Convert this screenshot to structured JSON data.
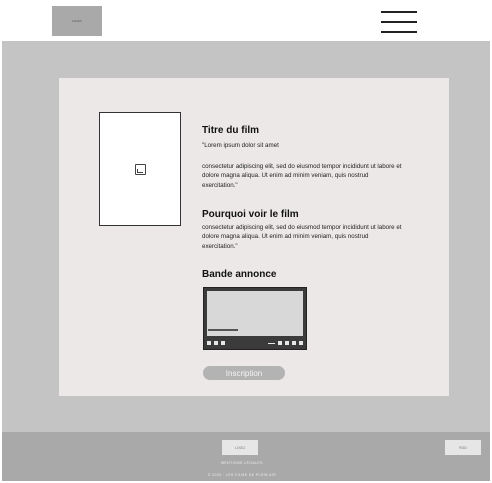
{
  "header": {
    "logo": "LOGO",
    "menu_icon": "hamburger-menu-icon"
  },
  "film": {
    "title": "Titre du film",
    "quote": "\"Lorem ipsum dolor sit amet",
    "description": "consectetur adipiscing elit, sed do eiusmod tempor incididunt ut labore et dolore magna aliqua. Ut enim ad minim veniam, quis nostrud exercitation.\"",
    "poster_icon": "image-placeholder-icon"
  },
  "why": {
    "title": "Pourquoi voir le film",
    "text": "consectetur adipiscing elit, sed do eiusmod tempor incididunt ut labore et dolore magna aliqua. Ut enim ad minim veniam, quis nostrud exercitation.\""
  },
  "trailer": {
    "title": "Bande annonce"
  },
  "cta": {
    "label": "Inscription"
  },
  "footer": {
    "logo": "LOGO",
    "right_box": "RGD",
    "legal": "MENTIONS LÉGALES",
    "copyright": "© 2020 · LES FILMS DE PLEIN AIR"
  }
}
